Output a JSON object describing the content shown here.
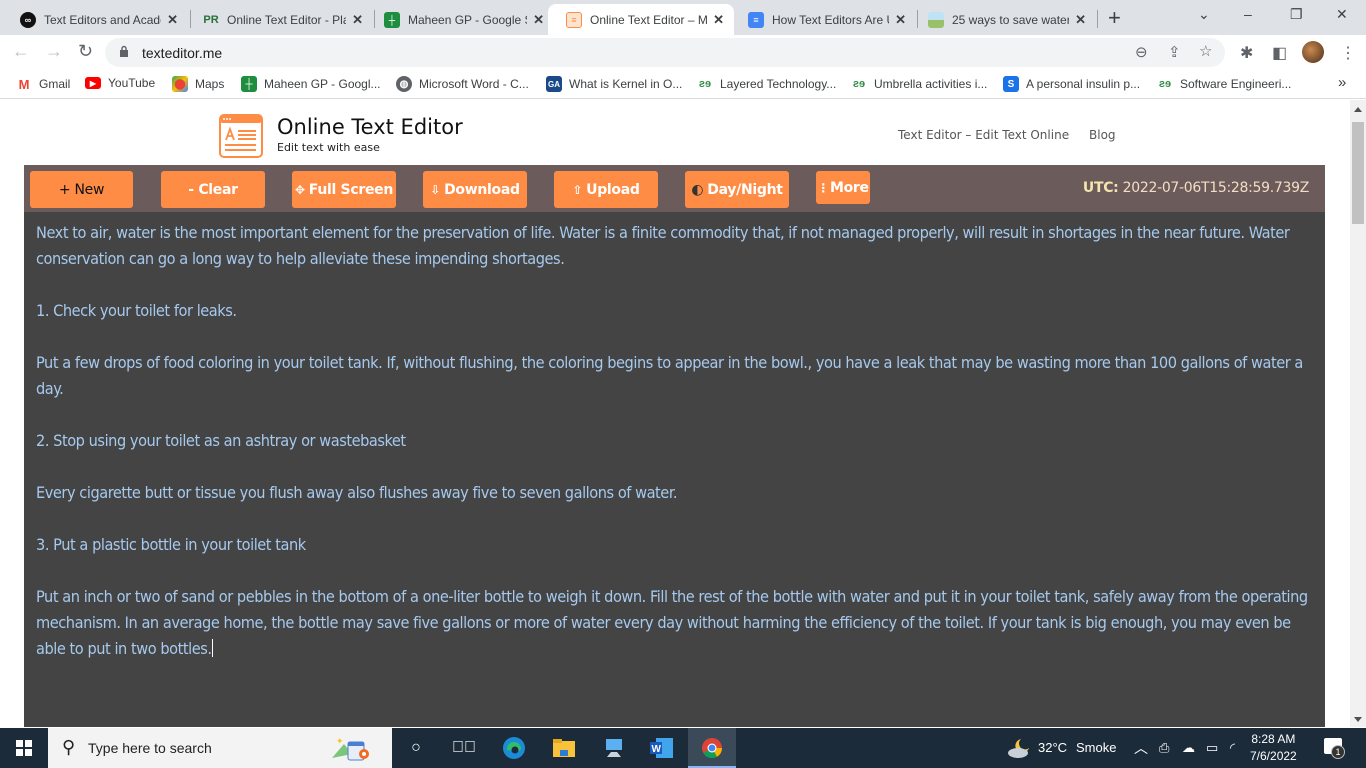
{
  "browser": {
    "tabs": [
      {
        "title": "Text Editors and Acade",
        "icon": "academia-icon",
        "active": false
      },
      {
        "title": "Online Text Editor - Pla",
        "icon": "pr-icon",
        "active": false
      },
      {
        "title": "Maheen GP - Google S",
        "icon": "google-sheets-icon",
        "active": false
      },
      {
        "title": "Online Text Editor – M",
        "icon": "texteditor-icon",
        "active": true
      },
      {
        "title": "How Text Editors Are U",
        "icon": "google-docs-icon",
        "active": false
      },
      {
        "title": "25 ways to save water",
        "icon": "landscape-icon",
        "active": false
      }
    ],
    "new_tab": "+",
    "window_controls": {
      "tab_search": "⌄",
      "minimize": "–",
      "restore": "❐",
      "close": "✕"
    },
    "url": "texteditor.me",
    "bookmarks": [
      {
        "label": "Gmail",
        "icon": "gmail-icon"
      },
      {
        "label": "YouTube",
        "icon": "youtube-icon"
      },
      {
        "label": "Maps",
        "icon": "maps-icon"
      },
      {
        "label": "Maheen GP - Googl...",
        "icon": "google-sheets-icon"
      },
      {
        "label": "Microsoft Word - C...",
        "icon": "globe-icon"
      },
      {
        "label": "What is Kernel in O...",
        "icon": "ga-icon"
      },
      {
        "label": "Layered Technology...",
        "icon": "gfg-icon"
      },
      {
        "label": "Umbrella activities i...",
        "icon": "gfg-icon"
      },
      {
        "label": "A personal insulin p...",
        "icon": "s-icon"
      },
      {
        "label": "Software Engineeri...",
        "icon": "gfg-icon"
      }
    ],
    "bookmarks_overflow": "»"
  },
  "site": {
    "title": "Online Text Editor",
    "tagline": "Edit text with ease",
    "nav": [
      "Text Editor – Edit Text Online",
      "Blog"
    ]
  },
  "editor_toolbar": {
    "buttons": [
      {
        "label": "+ New",
        "icon": ""
      },
      {
        "label": "- Clear",
        "icon": ""
      },
      {
        "label": "Full Screen",
        "icon": "✥"
      },
      {
        "label": "Download",
        "icon": "⇩"
      },
      {
        "label": "Upload",
        "icon": "⇧"
      },
      {
        "label": "Day/Night",
        "icon": "◐"
      },
      {
        "label": "More",
        "icon": "⋮"
      }
    ],
    "utc_label": "UTC:",
    "utc_value": "2022-07-06T15:28:59.739Z",
    "colors": {
      "bar": "#6b5b5b",
      "button": "#ff8c45",
      "editor_bg": "#444444",
      "editor_text": "#a6c9ee"
    }
  },
  "editor": {
    "paragraphs": [
      "Next to air, water is the most important element for the preservation of life. Water is a finite commodity that, if not managed properly, will result in shortages in the near future. Water conservation can go a long way to help alleviate these impending shortages.",
      "",
      "1. Check your toilet for leaks.",
      "",
      "Put a few drops of food coloring in your toilet tank. If, without flushing, the coloring begins to appear in the bowl., you have a leak that may be wasting more than 100 gallons of water a day.",
      "",
      "2. Stop using your toilet as an ashtray or wastebasket",
      "",
      "Every cigarette butt or tissue you flush away also flushes away five to seven gallons of water.",
      "",
      "3. Put a plastic bottle in your toilet tank",
      "",
      "Put an inch or two of sand or pebbles in the bottom of a one-liter bottle to weigh it down. Fill the rest of the bottle with water and put it in your toilet tank, safely away from the operating mechanism. In an average home, the bottle may save five gallons or more of water every day without harming the efficiency of the toilet. If your tank is big enough, you may even be able to put in two bottles."
    ]
  },
  "taskbar": {
    "search_placeholder": "Type here to search",
    "weather_temp": "32°C",
    "weather_desc": "Smoke",
    "time": "8:28 AM",
    "date": "7/6/2022",
    "notification_count": "1"
  }
}
